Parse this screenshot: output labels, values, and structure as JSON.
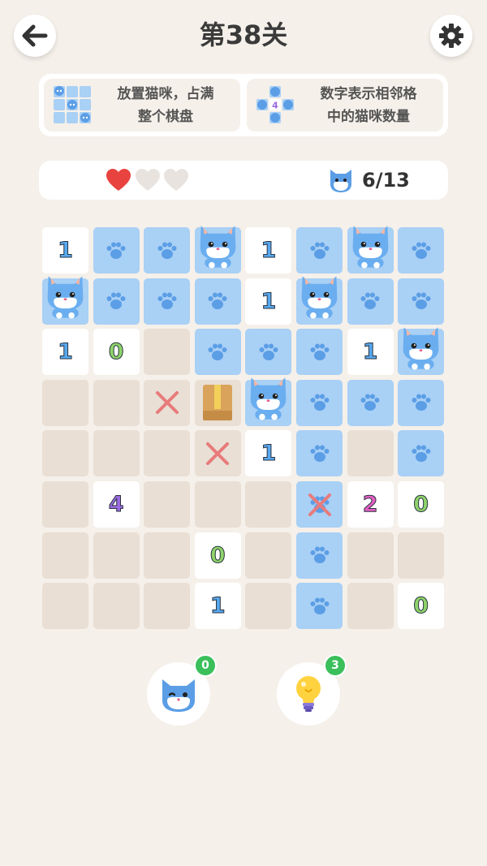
{
  "header": {
    "title": "第38关",
    "back_icon": "arrow-left-icon",
    "settings_icon": "gear-icon"
  },
  "rules": [
    {
      "text_line1": "放置猫咪，占满",
      "text_line2": "整个棋盘",
      "thumb": "cats-grid-thumbnail"
    },
    {
      "text_line1": "数字表示相邻格",
      "text_line2": "中的猫咪数量",
      "thumb": "number-neighbors-thumbnail",
      "thumb_number": "4"
    }
  ],
  "status": {
    "lives": [
      true,
      false,
      false
    ],
    "cat_count": "6/13",
    "cat_icon": "cat-face-icon"
  },
  "board": {
    "rows": 8,
    "cols": 8,
    "cells": [
      [
        "n1",
        "paw",
        "paw",
        "cat",
        "n1",
        "paw",
        "cat",
        "paw"
      ],
      [
        "cat",
        "paw",
        "paw",
        "paw",
        "n1",
        "cat",
        "paw",
        "paw"
      ],
      [
        "n1",
        "n0",
        "e",
        "paw",
        "paw",
        "paw",
        "n1",
        "cat"
      ],
      [
        "e",
        "e",
        "x",
        "box",
        "cat",
        "paw",
        "paw",
        "paw"
      ],
      [
        "e",
        "e",
        "e",
        "x",
        "n1",
        "paw",
        "e",
        "paw"
      ],
      [
        "e",
        "n4",
        "e",
        "e",
        "e",
        "xpaw",
        "n2",
        "n0"
      ],
      [
        "e",
        "e",
        "e",
        "n0",
        "e",
        "paw",
        "e",
        "e"
      ],
      [
        "e",
        "e",
        "e",
        "n1",
        "e",
        "paw",
        "e",
        "n0"
      ]
    ]
  },
  "colors": {
    "paw_cell": "#a9d0f5",
    "empty_cell": "#e9dfd4",
    "number_cell": "#ffffff",
    "heart_full": "#e8433f",
    "heart_empty": "#e8e3de",
    "badge": "#3bbf5b"
  },
  "tools": {
    "cat_hint": {
      "icon": "winking-cat-icon",
      "count": "0"
    },
    "bulb_hint": {
      "icon": "lightbulb-icon",
      "count": "3"
    }
  }
}
